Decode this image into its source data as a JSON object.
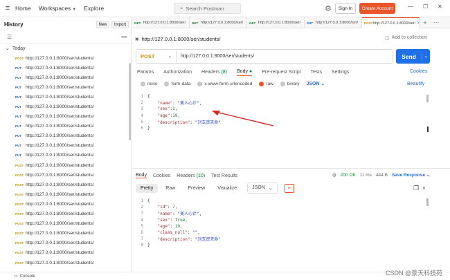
{
  "topbar": {
    "nav": [
      "Home",
      "Workspaces",
      "Explore"
    ],
    "search_placeholder": "Search Postman",
    "sign_in": "Sign In",
    "create_account": "Create Account"
  },
  "sidebar": {
    "title": "History",
    "new_label": "New",
    "import_label": "Import",
    "group": "Today",
    "items": [
      {
        "method": "POST",
        "url": "http://127.0.0.1:8000/ser/students/"
      },
      {
        "method": "PUT",
        "url": "http://127.0.0.1:8000/ser/students/"
      },
      {
        "method": "PUT",
        "url": "http://127.0.0.1:8000/ser/students/"
      },
      {
        "method": "PUT",
        "url": "http://127.0.0.1:8000/ser/students/"
      },
      {
        "method": "PUT",
        "url": "http://127.0.0.1:8000/ser/students/"
      },
      {
        "method": "PUT",
        "url": "http://127.0.0.1:8000/ser/students/"
      },
      {
        "method": "PUT",
        "url": "http://127.0.0.1:8000/ser/students/"
      },
      {
        "method": "PUT",
        "url": "http://127.0.0.1:8000/ser/students/"
      },
      {
        "method": "PUT",
        "url": "http://127.0.0.1:8000/ser/students/"
      },
      {
        "method": "PUT",
        "url": "http://127.0.0.1:8000/ser/students/"
      },
      {
        "method": "PUT",
        "url": "http://127.0.0.1:8000/ser/students/"
      },
      {
        "method": "POST",
        "url": "http://127.0.0.1:8000/ser/students/"
      },
      {
        "method": "POST",
        "url": "http://127.0.0.1:8000/ser/students/"
      },
      {
        "method": "POST",
        "url": "http://127.0.0.1:8000/ser/students/"
      },
      {
        "method": "POST",
        "url": "http://127.0.0.1:8000/ser/students/"
      },
      {
        "method": "POST",
        "url": "http://127.0.0.1:8000/ser/students/"
      },
      {
        "method": "POST",
        "url": "http://127.0.0.1:8000/ser/students/"
      },
      {
        "method": "POST",
        "url": "http://127.0.0.1:8000/ser/students/"
      },
      {
        "method": "POST",
        "url": "http://127.0.0.1:8000/ser/students/"
      },
      {
        "method": "POST",
        "url": "http://127.0.0.1:8000/ser/students/"
      },
      {
        "method": "POST",
        "url": "http://127.0.0.1:8000/ser/students/"
      },
      {
        "method": "POST",
        "url": "http://127.0.0.1:8000/ser/students/"
      }
    ]
  },
  "tabs": [
    {
      "method": "GET",
      "url": "http://127.0.0.1:8000/ser/"
    },
    {
      "method": "GET",
      "url": "http://127.0.0.1:8000/ser/"
    },
    {
      "method": "GET",
      "url": "http://127.0.0.1:8000/ser/"
    },
    {
      "method": "PUT",
      "url": "http://127.0.0.1:8000/ser/"
    },
    {
      "method": "POST",
      "url": "http://127.0.0.1:8000/ser/"
    }
  ],
  "request": {
    "title": "http://127.0.0.1:8000/ser/students/",
    "save_label": "Add to collection",
    "method": "POST",
    "url": "http://127.0.0.1:8000/ser/students/",
    "send_label": "Send",
    "tabs": [
      "Params",
      "Authorization",
      "Headers",
      "Body",
      "Pre-request Script",
      "Tests",
      "Settings"
    ],
    "headers_count": "(8)",
    "cookies_label": "Cookies",
    "body_options": [
      "none",
      "form-data",
      "x-www-form-urlencoded",
      "raw",
      "binary"
    ],
    "body_format": "JSON",
    "beautify_label": "Beautify",
    "body_lines": [
      {
        "n": "1",
        "parts": [
          {
            "t": "{",
            "c": "p"
          }
        ]
      },
      {
        "n": "2",
        "parts": [
          {
            "t": "    ",
            "c": "p"
          },
          {
            "t": "\"name\"",
            "c": "k"
          },
          {
            "t": ": ",
            "c": "p"
          },
          {
            "t": "\"美人心计\"",
            "c": "s"
          },
          {
            "t": ",",
            "c": "p"
          }
        ]
      },
      {
        "n": "3",
        "parts": [
          {
            "t": "    ",
            "c": "p"
          },
          {
            "t": "\"sex\"",
            "c": "k"
          },
          {
            "t": ":",
            "c": "p"
          },
          {
            "t": "1",
            "c": "n"
          },
          {
            "t": ",",
            "c": "p"
          }
        ]
      },
      {
        "n": "4",
        "parts": [
          {
            "t": "    ",
            "c": "p"
          },
          {
            "t": "\"age\"",
            "c": "k"
          },
          {
            "t": ":",
            "c": "p"
          },
          {
            "t": "19",
            "c": "n"
          },
          {
            "t": ",",
            "c": "p"
          }
        ]
      },
      {
        "n": "5",
        "parts": [
          {
            "t": "    ",
            "c": "p"
          },
          {
            "t": "\"description\"",
            "c": "k"
          },
          {
            "t": ": ",
            "c": "p"
          },
          {
            "t": "\"刘玉资天命\"",
            "c": "s"
          }
        ]
      },
      {
        "n": "6",
        "parts": [
          {
            "t": "}",
            "c": "p"
          }
        ]
      }
    ]
  },
  "response": {
    "tabs": [
      "Body",
      "Cookies",
      "Headers",
      "Test Results"
    ],
    "headers_count": "(10)",
    "status": "200 OK",
    "time": "11 ms",
    "size": "444 B",
    "save_response": "Save Response",
    "view_tabs": [
      "Pretty",
      "Raw",
      "Preview",
      "Visualize"
    ],
    "format": "JSON",
    "body_lines": [
      {
        "n": "1",
        "parts": [
          {
            "t": "{",
            "c": "p"
          }
        ]
      },
      {
        "n": "2",
        "parts": [
          {
            "t": "    ",
            "c": "p"
          },
          {
            "t": "\"id\"",
            "c": "k"
          },
          {
            "t": ": ",
            "c": "p"
          },
          {
            "t": "7",
            "c": "n"
          },
          {
            "t": ",",
            "c": "p"
          }
        ]
      },
      {
        "n": "3",
        "parts": [
          {
            "t": "    ",
            "c": "p"
          },
          {
            "t": "\"name\"",
            "c": "k"
          },
          {
            "t": ": ",
            "c": "p"
          },
          {
            "t": "\"美人心计\"",
            "c": "s"
          },
          {
            "t": ",",
            "c": "p"
          }
        ]
      },
      {
        "n": "4",
        "parts": [
          {
            "t": "    ",
            "c": "p"
          },
          {
            "t": "\"sex\"",
            "c": "k"
          },
          {
            "t": ": ",
            "c": "p"
          },
          {
            "t": "true",
            "c": "n"
          },
          {
            "t": ",",
            "c": "p"
          }
        ]
      },
      {
        "n": "5",
        "parts": [
          {
            "t": "    ",
            "c": "p"
          },
          {
            "t": "\"age\"",
            "c": "k"
          },
          {
            "t": ": ",
            "c": "p"
          },
          {
            "t": "19",
            "c": "n"
          },
          {
            "t": ",",
            "c": "p"
          }
        ]
      },
      {
        "n": "6",
        "parts": [
          {
            "t": "    ",
            "c": "p"
          },
          {
            "t": "\"class_null\"",
            "c": "k"
          },
          {
            "t": ": ",
            "c": "p"
          },
          {
            "t": "\"\"",
            "c": "s"
          },
          {
            "t": ",",
            "c": "p"
          }
        ]
      },
      {
        "n": "7",
        "parts": [
          {
            "t": "    ",
            "c": "p"
          },
          {
            "t": "\"description\"",
            "c": "k"
          },
          {
            "t": ": ",
            "c": "p"
          },
          {
            "t": "\"刘玉资天命\"",
            "c": "s"
          }
        ]
      },
      {
        "n": "8",
        "parts": [
          {
            "t": "}",
            "c": "p"
          }
        ]
      }
    ]
  },
  "statusbar": {
    "console_label": "Console"
  },
  "watermark": "CSDN @景天科技苑"
}
